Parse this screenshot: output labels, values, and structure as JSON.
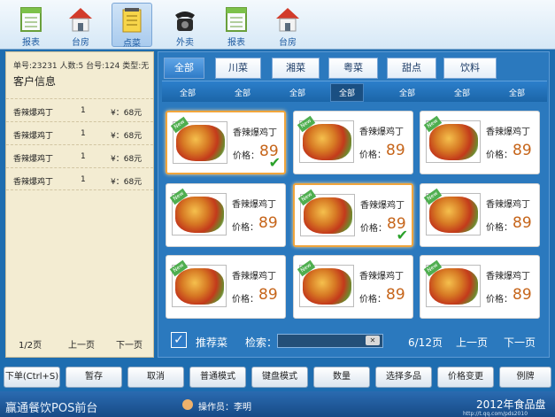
{
  "toolbar": {
    "items": [
      {
        "label": "报表",
        "icon": "report-icon"
      },
      {
        "label": "台房",
        "icon": "house-icon"
      },
      {
        "label": "点菜",
        "icon": "notepad-icon",
        "active": true
      },
      {
        "label": "外卖",
        "icon": "phone-icon"
      },
      {
        "label": "报表",
        "icon": "report-icon"
      },
      {
        "label": "台房",
        "icon": "house-icon"
      }
    ]
  },
  "order": {
    "info_line": "单号:23231  人数:5  台号:124  类型:无",
    "customer_label": "客户信息",
    "rows": [
      {
        "name": "香辣爆鸡丁",
        "qty": "1",
        "price": "¥：68元"
      },
      {
        "name": "香辣爆鸡丁",
        "qty": "1",
        "price": "¥：68元"
      },
      {
        "name": "香辣爆鸡丁",
        "qty": "1",
        "price": "¥：68元"
      },
      {
        "name": "香辣爆鸡丁",
        "qty": "1",
        "price": "¥：68元"
      }
    ],
    "pager": {
      "page": "1/2页",
      "prev": "上一页",
      "next": "下一页"
    }
  },
  "menu": {
    "tabs": [
      "全部",
      "川菜",
      "湘菜",
      "粤菜",
      "甜点",
      "饮料"
    ],
    "active_tab": 0,
    "subtabs": [
      "全部",
      "全部",
      "全部",
      "全部",
      "全部",
      "全部",
      "全部"
    ],
    "active_subtab": 3,
    "dishes": [
      {
        "name": "香辣爆鸡丁",
        "price_label": "价格：",
        "price": "89",
        "selected": true,
        "badge": "New"
      },
      {
        "name": "香辣爆鸡丁",
        "price_label": "价格：",
        "price": "89",
        "selected": false,
        "badge": "New"
      },
      {
        "name": "香辣爆鸡丁",
        "price_label": "价格：",
        "price": "89",
        "selected": false,
        "badge": "New"
      },
      {
        "name": "香辣爆鸡丁",
        "price_label": "价格：",
        "price": "89",
        "selected": false,
        "badge": "New"
      },
      {
        "name": "香辣爆鸡丁",
        "price_label": "价格：",
        "price": "89",
        "selected": true,
        "badge": "New"
      },
      {
        "name": "香辣爆鸡丁",
        "price_label": "价格：",
        "price": "89",
        "selected": false,
        "badge": "New"
      },
      {
        "name": "香辣爆鸡丁",
        "price_label": "价格：",
        "price": "89",
        "selected": false,
        "badge": "New"
      },
      {
        "name": "香辣爆鸡丁",
        "price_label": "价格：",
        "price": "89",
        "selected": false,
        "badge": "New"
      },
      {
        "name": "香辣爆鸡丁",
        "price_label": "价格：",
        "price": "89",
        "selected": false,
        "badge": "New"
      }
    ],
    "footer": {
      "recommend_label": "推荐菜",
      "search_label": "检索：",
      "search_value": "",
      "page": "6/12页",
      "prev": "上一页",
      "next": "下一页"
    }
  },
  "actions": [
    "下单(Ctrl+S)",
    "暂存",
    "取消",
    "普通模式",
    "键盘模式",
    "数量",
    "选择多品",
    "价格变更",
    "例牌"
  ],
  "status": {
    "brand": "赢通餐饮POS前台",
    "operator": "操作员：李明",
    "clock": "2012年食品盘",
    "watermark": "http://t.qq.com/pds2010"
  },
  "colors": {
    "accent": "#2b79be",
    "price": "#c6651a",
    "selected_border": "#f1a53c",
    "check": "#2aa12a"
  }
}
